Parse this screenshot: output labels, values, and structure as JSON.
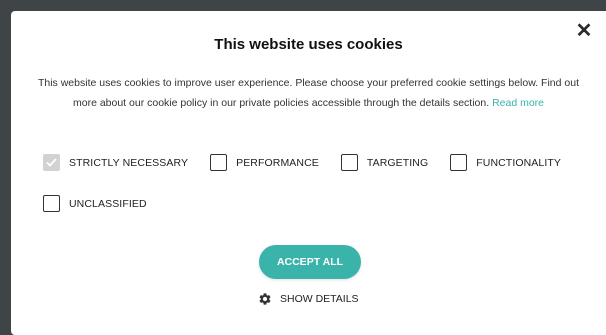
{
  "dialog": {
    "title": "This website uses cookies",
    "close_symbol": "✕",
    "description": "This website uses cookies to improve user experience. Please choose your preferred cookie settings below. Find out more about our cookie policy in our private policies accessible through the details section.",
    "read_more_label": "Read more"
  },
  "checkboxes": [
    {
      "label": "STRICTLY NECESSARY",
      "checked": true,
      "disabled": true
    },
    {
      "label": "PERFORMANCE",
      "checked": false
    },
    {
      "label": "TARGETING",
      "checked": false
    },
    {
      "label": "FUNCTIONALITY",
      "checked": false
    },
    {
      "label": "UNCLASSIFIED",
      "checked": false
    }
  ],
  "actions": {
    "accept_all_label": "ACCEPT ALL",
    "show_details_label": "SHOW DETAILS"
  },
  "icons": {
    "close": "close-icon",
    "checkmark": "checkmark-icon",
    "gear": "gear-icon"
  },
  "colors": {
    "accent": "#3ab3ab",
    "backdrop": "#3f4447",
    "text": "#222222",
    "checked_box": "#d2d2d2"
  }
}
